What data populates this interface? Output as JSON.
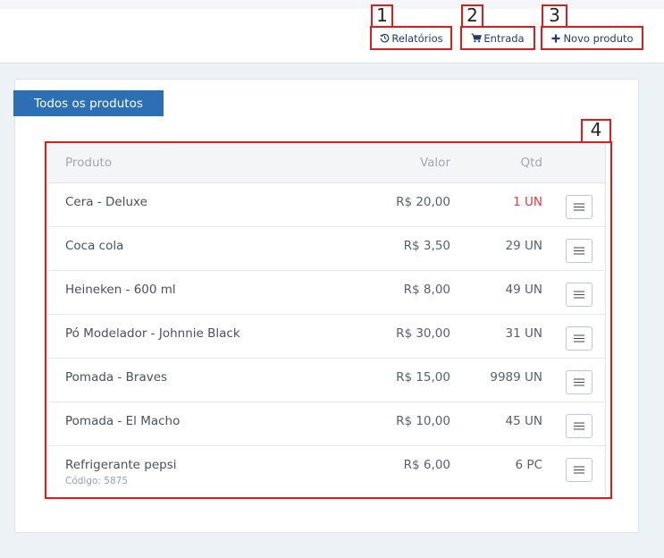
{
  "header": {
    "buttons": [
      {
        "label": "Relatórios",
        "icon": "history-icon",
        "marker": "1"
      },
      {
        "label": "Entrada",
        "icon": "cart-icon",
        "marker": "2"
      },
      {
        "label": "Novo produto",
        "icon": "plus-icon",
        "marker": "3"
      }
    ]
  },
  "card": {
    "title": "Todos os produtos",
    "table_marker": "4"
  },
  "table": {
    "columns": [
      "Produto",
      "Valor",
      "Qtd"
    ],
    "rows": [
      {
        "name": "Cera - Deluxe",
        "value": "R$ 20,00",
        "qty": "1 UN",
        "code": ""
      },
      {
        "name": "Coca cola",
        "value": "R$ 3,50",
        "qty": "29 UN",
        "code": ""
      },
      {
        "name": "Heineken - 600 ml",
        "value": "R$ 8,00",
        "qty": "49 UN",
        "code": ""
      },
      {
        "name": "Pó Modelador - Johnnie Black",
        "value": "R$ 30,00",
        "qty": "31 UN",
        "code": ""
      },
      {
        "name": "Pomada - Braves",
        "value": "R$ 15,00",
        "qty": "9989 UN",
        "code": ""
      },
      {
        "name": "Pomada - El Macho",
        "value": "R$ 10,00",
        "qty": "45 UN",
        "code": ""
      },
      {
        "name": "Refrigerante pepsi",
        "value": "R$ 6,00",
        "qty": "6 PC",
        "code": "Código: 5875"
      }
    ],
    "row_action_icon": "menu-icon"
  },
  "colors": {
    "accent": "#2d6fb4",
    "annotation": "#e01b1b",
    "low_stock": "#e23b3b",
    "background": "#edf2f6"
  }
}
